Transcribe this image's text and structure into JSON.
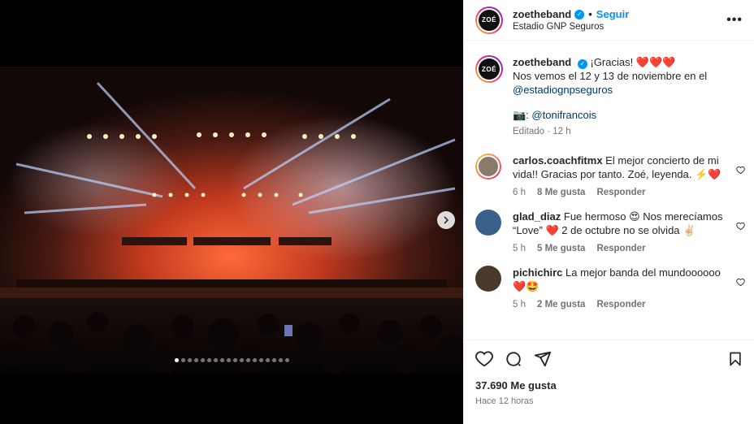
{
  "post": {
    "username": "zoetheband",
    "follow_label": "Seguir",
    "location": "Estadio GNP Seguros",
    "avatar_text": "ZOÉ",
    "more_icon": "more-horizontal-icon"
  },
  "caption": {
    "username": "zoetheband",
    "line1": "¡Gracias! ❤️❤️❤️",
    "line2": "Nos vemos el 12 y 13 de noviembre en el",
    "mention1": "@estadiognpseguros",
    "camera": "📷: ",
    "mention2": "@tonifrancois",
    "edited": "Editado · 12 h"
  },
  "comments": [
    {
      "username": "carlos.coachfitmx",
      "text": "El mejor concierto de mi vida!! Gracias por tanto. Zoé, leyenda. ⚡️❤️",
      "time": "6 h",
      "likes": "8 Me gusta",
      "reply": "Responder"
    },
    {
      "username": "glad_diaz",
      "text": "Fue hermoso 😍 Nos merecíamos “Love” ❤️ 2 de octubre no se olvida ✌🏻",
      "time": "5 h",
      "likes": "5 Me gusta",
      "reply": "Responder"
    },
    {
      "username": "pichichirc",
      "text": "La mejor banda del mundoooooo ❤️🤩",
      "time": "5 h",
      "likes": "2 Me gusta",
      "reply": "Responder"
    }
  ],
  "footer": {
    "likes": "37.690 Me gusta",
    "posted": "Hace 12 horas"
  },
  "carousel": {
    "total": 18,
    "current": 1
  },
  "colors": {
    "accent": "#0095f6",
    "verified": "#0095f6",
    "muted": "#737373",
    "link": "#00376b"
  }
}
